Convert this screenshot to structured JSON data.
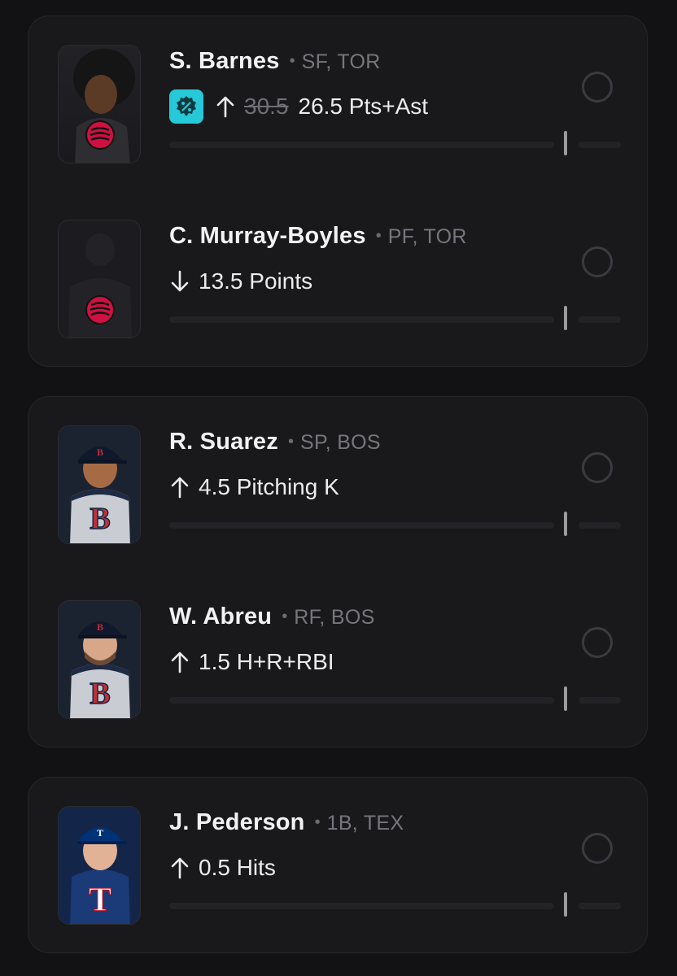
{
  "cards": [
    {
      "players": [
        {
          "name": "S. Barnes",
          "position": "SF, TOR",
          "direction": "up",
          "promo": true,
          "old_line": "30.5",
          "stat": "26.5 Pts+Ast",
          "team_logo": "raptors-logo",
          "headshot": "player-headshot"
        },
        {
          "name": "C. Murray-Boyles",
          "position": "PF, TOR",
          "direction": "down",
          "promo": false,
          "old_line": "",
          "stat": "13.5 Points",
          "team_logo": "raptors-logo",
          "headshot": "silhouette-placeholder"
        }
      ]
    },
    {
      "players": [
        {
          "name": "R. Suarez",
          "position": "SP, BOS",
          "direction": "up",
          "promo": false,
          "old_line": "",
          "stat": "4.5 Pitching K",
          "team_logo": "red-sox-logo",
          "headshot": "player-headshot"
        },
        {
          "name": "W. Abreu",
          "position": "RF, BOS",
          "direction": "up",
          "promo": false,
          "old_line": "",
          "stat": "1.5 H+R+RBI",
          "team_logo": "red-sox-logo",
          "headshot": "player-headshot"
        }
      ]
    },
    {
      "players": [
        {
          "name": "J. Pederson",
          "position": "1B, TEX",
          "direction": "up",
          "promo": false,
          "old_line": "",
          "stat": "0.5 Hits",
          "team_logo": "rangers-logo",
          "headshot": "player-headshot"
        }
      ]
    }
  ],
  "colors": {
    "background": "#121214",
    "card": "#19191c",
    "promo_badge": "#27c8d8",
    "raptors_red": "#ce1141",
    "red_sox_red": "#bd3039",
    "rangers_navy": "#003278"
  }
}
